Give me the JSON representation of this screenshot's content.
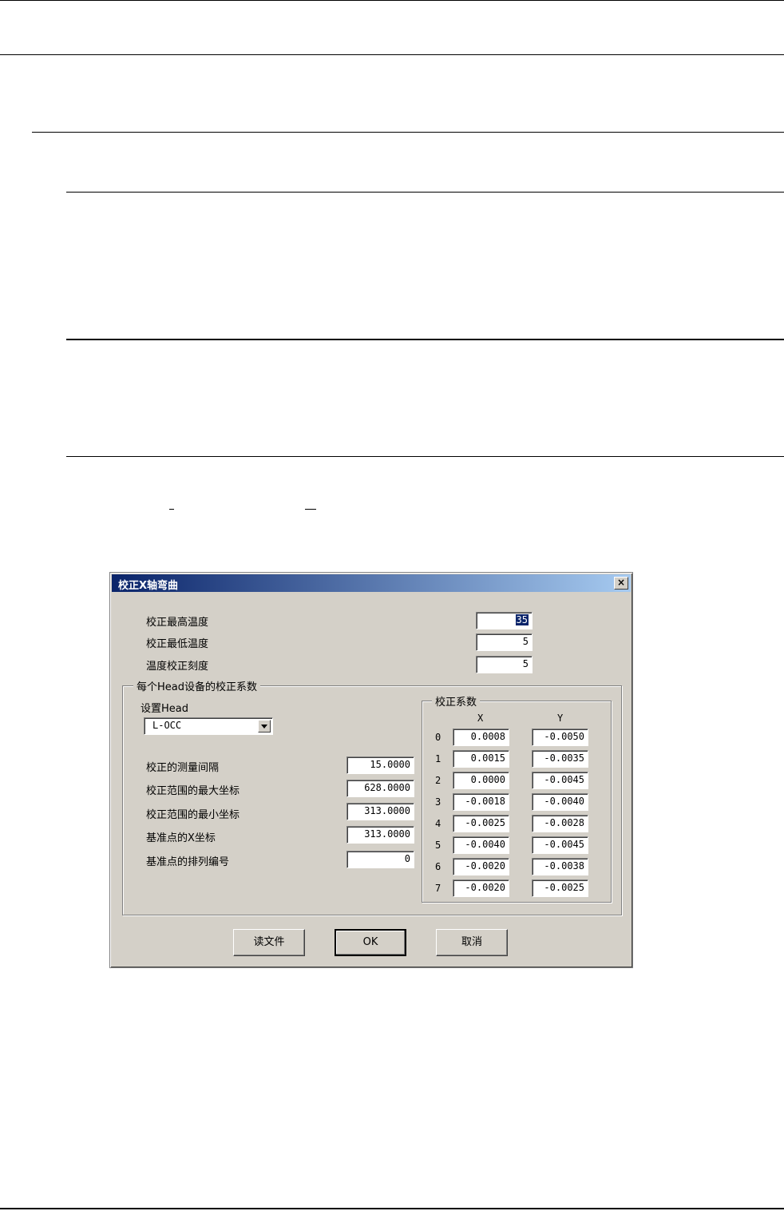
{
  "dialog": {
    "title": "校正X轴弯曲",
    "close_label": "×",
    "temp_max_label": "校正最高温度",
    "temp_max_value": "35",
    "temp_min_label": "校正最低温度",
    "temp_min_value": "5",
    "temp_step_label": "温度校正刻度",
    "temp_step_value": "5"
  },
  "head_group": {
    "title": "每个Head设备的校正系数",
    "set_head_label": "设置Head",
    "head_selected": "L-OCC",
    "fields": [
      {
        "label": "校正的测量间隔",
        "value": "15.0000"
      },
      {
        "label": "校正范围的最大坐标",
        "value": "628.0000"
      },
      {
        "label": "校正范围的最小坐标",
        "value": "313.0000"
      },
      {
        "label": "基准点的X坐标",
        "value": "313.0000"
      },
      {
        "label": "基准点的排列编号",
        "value": "0"
      }
    ]
  },
  "coef_group": {
    "title": "校正系数",
    "col_x": "X",
    "col_y": "Y",
    "rows": [
      {
        "idx": "0",
        "x": "0.0008",
        "y": "-0.0050"
      },
      {
        "idx": "1",
        "x": "0.0015",
        "y": "-0.0035"
      },
      {
        "idx": "2",
        "x": "0.0000",
        "y": "-0.0045"
      },
      {
        "idx": "3",
        "x": "-0.0018",
        "y": "-0.0040"
      },
      {
        "idx": "4",
        "x": "-0.0025",
        "y": "-0.0028"
      },
      {
        "idx": "5",
        "x": "-0.0040",
        "y": "-0.0045"
      },
      {
        "idx": "6",
        "x": "-0.0020",
        "y": "-0.0038"
      },
      {
        "idx": "7",
        "x": "-0.0020",
        "y": "-0.0025"
      }
    ]
  },
  "buttons": {
    "read_file": "读文件",
    "ok": "OK",
    "cancel": "取消"
  }
}
